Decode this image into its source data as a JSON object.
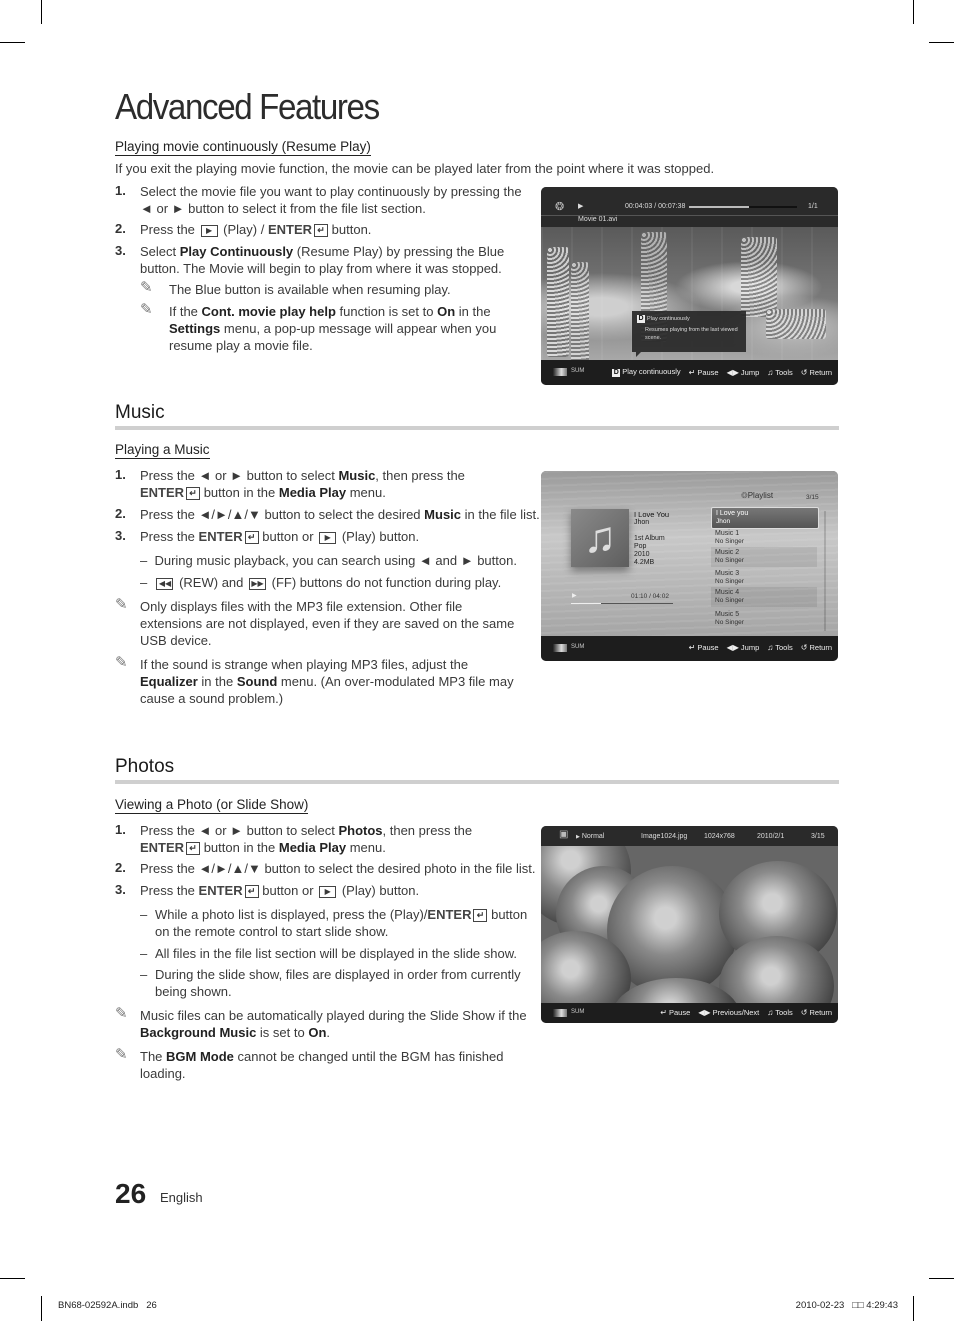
{
  "page": {
    "title": "Advanced Features",
    "page_number": "26",
    "language": "English",
    "slug_left": "BN68-02592A.indb   26",
    "slug_right": "2010-02-23   □□ 4:29:43"
  },
  "resume": {
    "subhead": "Playing movie continuously (Resume Play)",
    "intro": "If you exit the playing movie function, the movie can be played later from the point where it was stopped.",
    "steps": [
      {
        "num": "1.",
        "text": "Select the movie file you want to play continuously by pressing the ◄ or ► button to select it from the file list section."
      },
      {
        "num": "2.",
        "pre": "Press the",
        "mid": "(Play) /",
        "bold": "ENTER",
        "post": "button."
      },
      {
        "num": "3.",
        "pre": "Select",
        "bold": "Play Continuously",
        "post": "(Resume Play) by pressing the Blue button. The Movie will begin to play from where it was stopped."
      }
    ],
    "notes": [
      {
        "text": "The Blue button is available when resuming play."
      },
      {
        "pre": "If the",
        "b1": "Cont. movie play help",
        "mid1": "function is set to",
        "b2": "On",
        "mid2": "in the",
        "b3": "Settings",
        "post": "menu, a pop-up message will appear when you resume play a movie file."
      }
    ],
    "screen": {
      "time": "00:04:03 / 00:07:38",
      "progress": 0.56,
      "count": "1/1",
      "filename": "Movie 01.avi",
      "popup_title": "Play continuously",
      "popup_body": "Resumes playing from the last viewed scene.",
      "device": "SUM",
      "controls": [
        {
          "icon": "d-key-icon",
          "glyph": "D",
          "label": "Play continuously"
        },
        {
          "icon": "enter-icon",
          "glyph": "↵",
          "label": "Pause"
        },
        {
          "icon": "left-right-icon",
          "glyph": "◀▶",
          "label": "Jump"
        },
        {
          "icon": "tools-icon",
          "glyph": "♫",
          "label": "Tools"
        },
        {
          "icon": "return-icon",
          "glyph": "↺",
          "label": "Return"
        }
      ]
    }
  },
  "music": {
    "heading": "Music",
    "subhead": "Playing a Music",
    "steps": [
      {
        "num": "1.",
        "pre": "Press the ◄ or ► button to select",
        "b1": "Music",
        "mid": ", then press the",
        "b2": "ENTER",
        "mid2": "button in the",
        "b3": "Media Play",
        "post": "menu."
      },
      {
        "num": "2.",
        "pre": "Press the ◄/►/▲/▼ button to select the desired",
        "b1": "Music",
        "post": "in the file list."
      },
      {
        "num": "3.",
        "pre": "Press the",
        "b1": "ENTER",
        "mid": "button or",
        "post": "(Play) button."
      }
    ],
    "dashes": [
      "During music playback, you can search using  ◄ and ► button.",
      "(REW) and",
      "(FF) buttons do not function during play."
    ],
    "notes": [
      {
        "text": "Only displays files with the MP3 file extension. Other file extensions are not displayed, even if they are saved on the same USB device."
      },
      {
        "pre": "If the sound is strange when playing MP3 files, adjust the",
        "b1": "Equalizer",
        "mid": "in the",
        "b2": "Sound",
        "post": "menu. (An over-modulated MP3 file may cause a sound problem.)"
      }
    ],
    "screen": {
      "playlist_label": "Playlist",
      "count": "3/15",
      "song_title": "I Love You",
      "artist": "Jhon",
      "album": "1st Album",
      "genre": "Pop",
      "year": "2010",
      "size": "4.2MB",
      "time": "01:10 / 04:02",
      "progress": 0.29,
      "playlist": [
        {
          "title": "I Love you",
          "singer": "Jhon",
          "selected": true
        },
        {
          "title": "Music 1",
          "singer": "No Singer"
        },
        {
          "title": "Music 2",
          "singer": "No Singer"
        },
        {
          "title": "Music 3",
          "singer": "No Singer"
        },
        {
          "title": "Music 4",
          "singer": "No Singer"
        },
        {
          "title": "Music 5",
          "singer": "No Singer"
        }
      ],
      "device": "SUM",
      "controls": [
        {
          "icon": "enter-icon",
          "glyph": "↵",
          "label": "Pause"
        },
        {
          "icon": "left-right-icon",
          "glyph": "◀▶",
          "label": "Jump"
        },
        {
          "icon": "tools-icon",
          "glyph": "♫",
          "label": "Tools"
        },
        {
          "icon": "return-icon",
          "glyph": "↺",
          "label": "Return"
        }
      ]
    }
  },
  "photos": {
    "heading": "Photos",
    "subhead": "Viewing a Photo (or Slide Show)",
    "steps": [
      {
        "num": "1.",
        "pre": "Press the ◄ or ► button to select",
        "b1": "Photos",
        "mid": ", then press the",
        "b2": "ENTER",
        "mid2": "button in the",
        "b3": "Media Play",
        "post": "menu."
      },
      {
        "num": "2.",
        "text": "Press the ◄/►/▲/▼ button to select the desired photo in the file list."
      },
      {
        "num": "3.",
        "pre": "Press the",
        "b1": "ENTER",
        "mid": "button or",
        "post": "(Play) button."
      }
    ],
    "dashes": [
      {
        "pre": "While a photo list is displayed, press the (Play)/",
        "b1": "ENTER",
        "post": "button on the remote control to start slide show."
      },
      {
        "text": "All files in the file list section will be displayed in the slide show."
      },
      {
        "text": "During the slide show, files are displayed in order from currently being shown."
      }
    ],
    "notes": [
      {
        "pre": "Music files can be automatically played during the Slide Show if the",
        "b1": "Background Music",
        "mid": "is set to",
        "b2": "On",
        "post": "."
      },
      {
        "pre": "The",
        "b1": "BGM Mode",
        "post": "cannot be changed until the BGM has finished loading."
      }
    ],
    "screen": {
      "mode": "Normal",
      "filename": "Image1024.jpg",
      "resolution": "1024x768",
      "date": "2010/2/1",
      "count": "3/15",
      "device": "SUM",
      "controls": [
        {
          "icon": "enter-icon",
          "glyph": "↵",
          "label": "Pause"
        },
        {
          "icon": "left-right-icon",
          "glyph": "◀▶",
          "label": "Previous/Next"
        },
        {
          "icon": "tools-icon",
          "glyph": "♫",
          "label": "Tools"
        },
        {
          "icon": "return-icon",
          "glyph": "↺",
          "label": "Return"
        }
      ]
    }
  }
}
